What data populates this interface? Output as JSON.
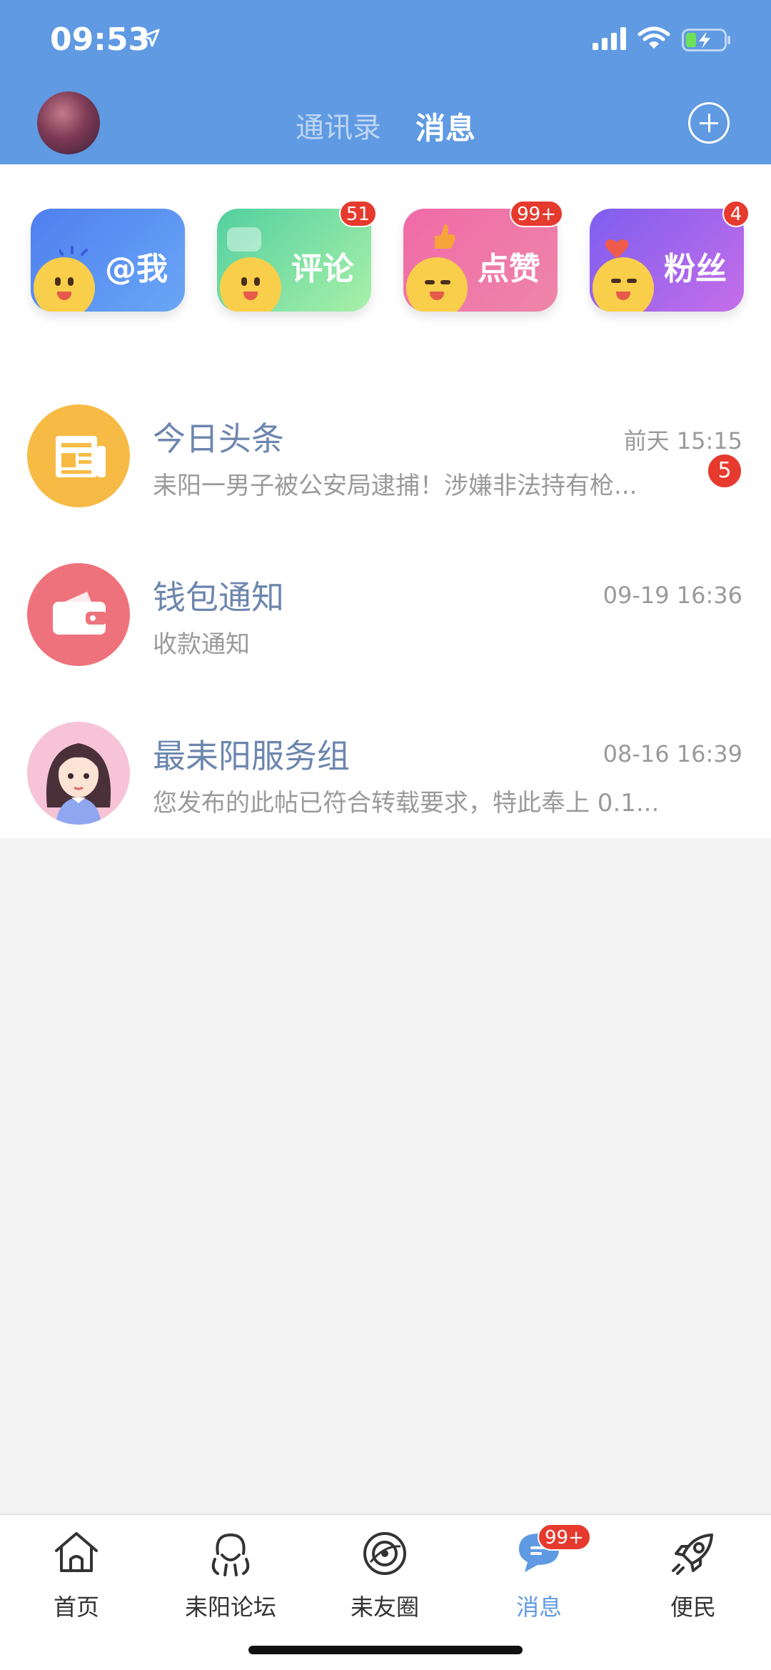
{
  "status_bar": {
    "time": "09:53"
  },
  "header": {
    "tabs": [
      {
        "label": "通讯录"
      },
      {
        "label": "消息"
      }
    ]
  },
  "categories": [
    {
      "label": "@我",
      "colors": [
        "#4e7ff0",
        "#6aa7f5"
      ]
    },
    {
      "label": "评论",
      "badge": "51",
      "colors": [
        "#53d0a0",
        "#a8f0a8"
      ]
    },
    {
      "label": "点赞",
      "badge": "99+",
      "colors": [
        "#f06aa8",
        "#ee86a8"
      ]
    },
    {
      "label": "粉丝",
      "badge": "4",
      "colors": [
        "#7e5ef0",
        "#c56ee8"
      ]
    }
  ],
  "messages": [
    {
      "title": "今日头条",
      "time": "前天 15:15",
      "preview": "耒阳一男子被公安局逮捕！涉嫌非法持有枪...",
      "badge": "5",
      "icon": "newspaper-icon",
      "icon_color": "#f7bb45"
    },
    {
      "title": "钱包通知",
      "time": "09-19 16:36",
      "preview": "收款通知",
      "icon": "wallet-icon",
      "icon_color": "#ee727c"
    },
    {
      "title": "最耒阳服务组",
      "time": "08-16 16:39",
      "preview": "您发布的此帖已符合转载要求，特此奉上 0.1...",
      "icon": "girl-avatar"
    }
  ],
  "tabbar": {
    "items": [
      {
        "label": "首页",
        "icon": "home-icon"
      },
      {
        "label": "耒阳论坛",
        "icon": "forum-icon"
      },
      {
        "label": "耒友圈",
        "icon": "circle-icon"
      },
      {
        "label": "消息",
        "icon": "chat-icon",
        "badge": "99+",
        "active": true
      },
      {
        "label": "便民",
        "icon": "rocket-icon"
      }
    ]
  },
  "accent_color": "#5f9ae2"
}
